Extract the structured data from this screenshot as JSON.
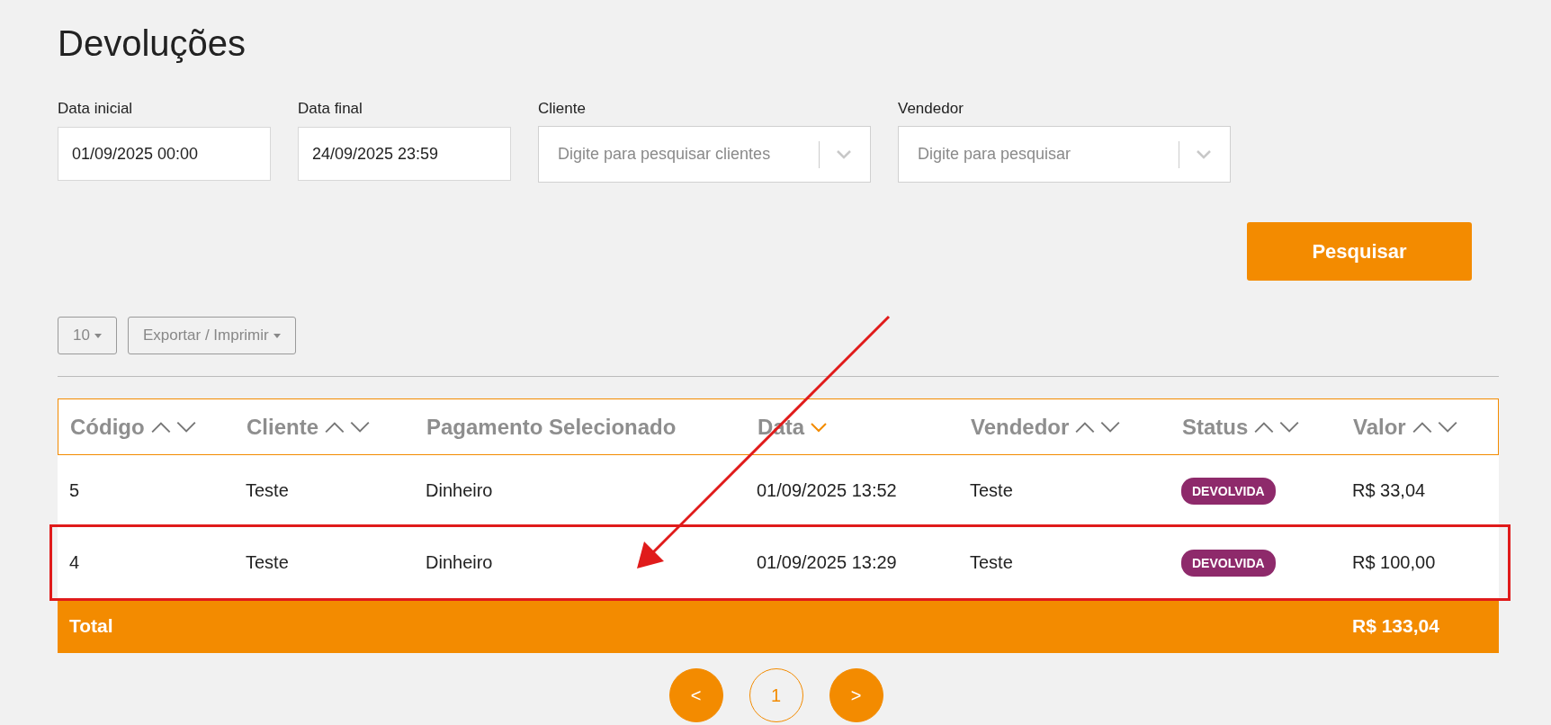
{
  "title": "Devoluções",
  "filters": [
    {
      "kind": "date",
      "label": "Data inicial",
      "value": "01/09/2025 00:00"
    },
    {
      "kind": "date",
      "label": "Data final",
      "value": "24/09/2025 23:59"
    },
    {
      "kind": "select",
      "label": "Cliente",
      "placeholder": "Digite para pesquisar clientes"
    },
    {
      "kind": "select",
      "label": "Vendedor",
      "placeholder": "Digite para pesquisar"
    }
  ],
  "search_button": "Pesquisar",
  "page_size": "10",
  "export_button": "Exportar / Imprimir",
  "table": {
    "columns": [
      {
        "label": "Código",
        "sortable": true,
        "sorted_desc": false
      },
      {
        "label": "Cliente",
        "sortable": true,
        "sorted_desc": false
      },
      {
        "label": "Pagamento Selecionado",
        "sortable": false
      },
      {
        "label": "Data",
        "sortable": true,
        "sorted_desc": true
      },
      {
        "label": "Vendedor",
        "sortable": true,
        "sorted_desc": false
      },
      {
        "label": "Status",
        "sortable": true,
        "sorted_desc": false
      },
      {
        "label": "Valor",
        "sortable": true,
        "sorted_desc": false
      }
    ],
    "rows": [
      {
        "cells": [
          "5",
          "Teste",
          "Dinheiro",
          "01/09/2025 13:52",
          "Teste"
        ],
        "status": "DEVOLVIDA",
        "value": "R$ 33,04",
        "highlighted": false
      },
      {
        "cells": [
          "4",
          "Teste",
          "Dinheiro",
          "01/09/2025 13:29",
          "Teste"
        ],
        "status": "DEVOLVIDA",
        "value": "R$ 100,00",
        "highlighted": true
      }
    ],
    "total_label": "Total",
    "total_value": "R$ 133,04"
  },
  "pagination": {
    "prev": "<",
    "pages": [
      {
        "label": "1",
        "selected": true
      }
    ],
    "next": ">"
  }
}
